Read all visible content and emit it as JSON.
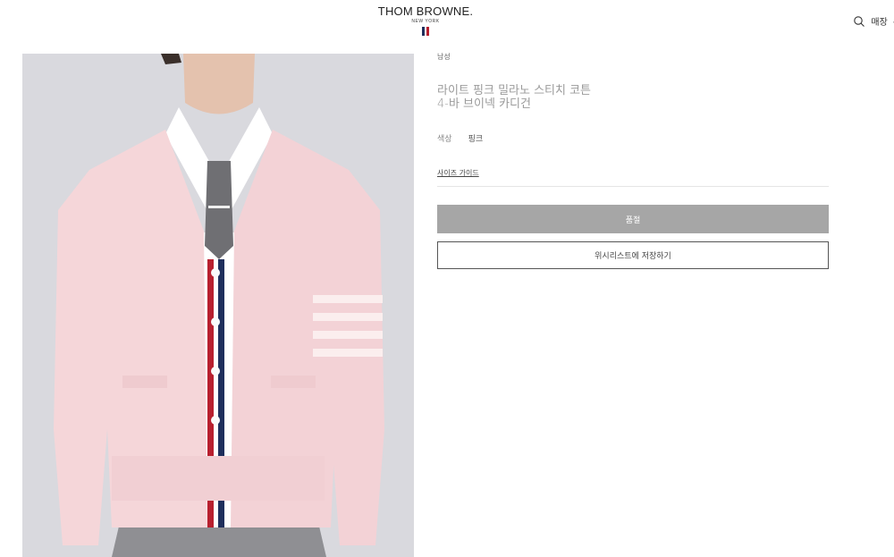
{
  "header": {
    "brand": "THOM BROWNE.",
    "brand_sub": "NEW YORK",
    "store_label": "매장",
    "overflow_label": "누"
  },
  "product": {
    "category": "남성",
    "title": "라이트 핑크 밀라노 스티치 코튼 4-바 브이넥 카디건",
    "color_label": "색상",
    "color_value": "핑크",
    "size_guide_label": "사이즈 가이드",
    "soldout_label": "품절",
    "wishlist_label": "위시리스트에 저장하기"
  },
  "colors": {
    "background_image": "#d9d9de",
    "cardigan": "#f5d6d9",
    "soldout_button": "#a6a6a6",
    "flag_navy": "#1f2f5c",
    "flag_red": "#b8202f"
  },
  "icons": {
    "search": "search-icon"
  }
}
